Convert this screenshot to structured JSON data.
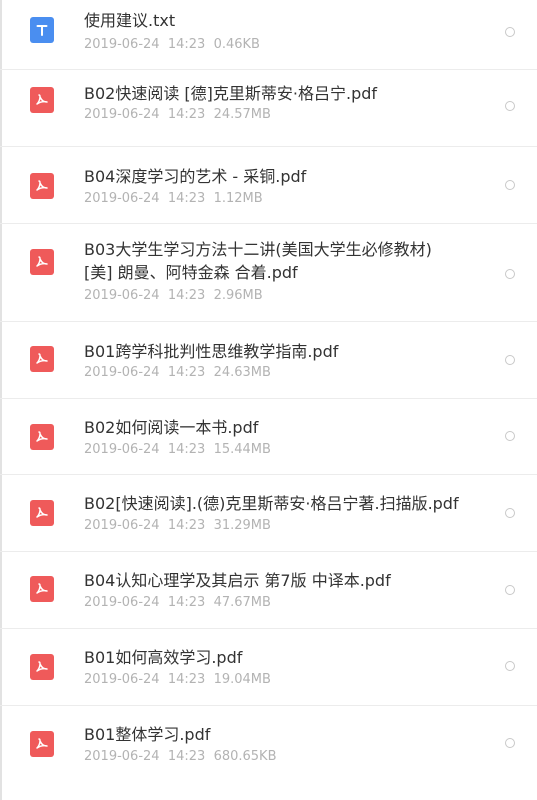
{
  "files": [
    {
      "name": "使用建议.txt",
      "date": "2019-06-24",
      "time": "14:23",
      "size": "0.46KB",
      "type": "txt"
    },
    {
      "name": "B02快速阅读  [德]克里斯蒂安·格吕宁.pdf",
      "date": "2019-06-24",
      "time": "14:23",
      "size": "24.57MB",
      "type": "pdf"
    },
    {
      "name": "B04深度学习的艺术 - 采铜.pdf",
      "date": "2019-06-24",
      "time": "14:23",
      "size": "1.12MB",
      "type": "pdf"
    },
    {
      "name": "B03大学生学习方法十二讲(美国大学生必修教材)\n[美] 朗曼、阿特金森 合着.pdf",
      "date": "2019-06-24",
      "time": "14:23",
      "size": "2.96MB",
      "type": "pdf"
    },
    {
      "name": "B01跨学科批判性思维教学指南.pdf",
      "date": "2019-06-24",
      "time": "14:23",
      "size": "24.63MB",
      "type": "pdf"
    },
    {
      "name": "B02如何阅读一本书.pdf",
      "date": "2019-06-24",
      "time": "14:23",
      "size": "15.44MB",
      "type": "pdf"
    },
    {
      "name": "B02[快速阅读].(德)克里斯蒂安·格吕宁著.扫描版.pdf",
      "date": "2019-06-24",
      "time": "14:23",
      "size": "31.29MB",
      "type": "pdf"
    },
    {
      "name": "B04认知心理学及其启示 第7版 中译本.pdf",
      "date": "2019-06-24",
      "time": "14:23",
      "size": "47.67MB",
      "type": "pdf"
    },
    {
      "name": "B01如何高效学习.pdf",
      "date": "2019-06-24",
      "time": "14:23",
      "size": "19.04MB",
      "type": "pdf"
    },
    {
      "name": "B01整体学习.pdf",
      "date": "2019-06-24",
      "time": "14:23",
      "size": "680.65KB",
      "type": "pdf"
    }
  ]
}
